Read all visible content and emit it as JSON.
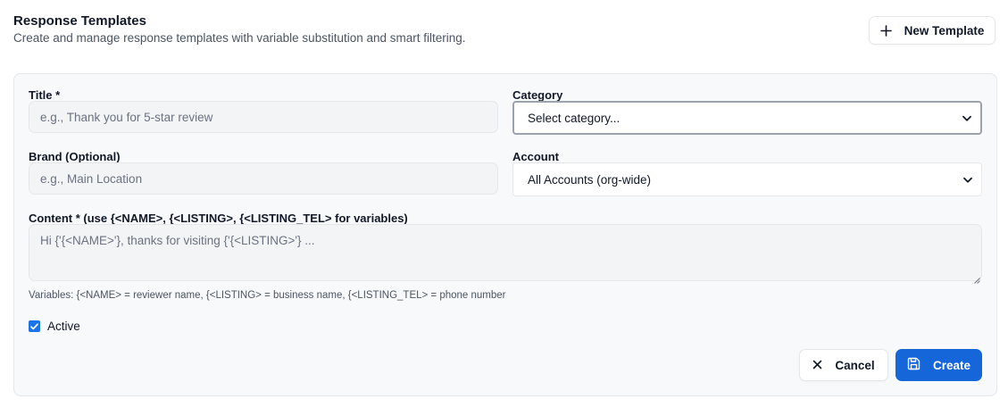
{
  "header": {
    "title": "Response Templates",
    "subtitle": "Create and manage response templates with variable substitution and smart filtering.",
    "new_button_label": "New Template"
  },
  "form": {
    "title": {
      "label": "Title *",
      "value": "",
      "placeholder": "e.g., Thank you for 5-star review"
    },
    "category": {
      "label": "Category",
      "selected": "Select category..."
    },
    "brand": {
      "label": "Brand (Optional)",
      "value": "",
      "placeholder": "e.g., Main Location"
    },
    "account": {
      "label": "Account",
      "selected": "All Accounts (org-wide)"
    },
    "content": {
      "label": "Content * (use {<NAME>, {<LISTING>, {<LISTING_TEL> for variables)",
      "value": "",
      "placeholder": "Hi {'{<NAME>'}, thanks for visiting {'{<LISTING>'} ..."
    },
    "variables_hint": "Variables: {<NAME> = reviewer name, {<LISTING> = business name, {<LISTING_TEL> = phone number",
    "active": {
      "label": "Active",
      "checked": true
    }
  },
  "actions": {
    "cancel_label": "Cancel",
    "create_label": "Create"
  },
  "colors": {
    "primary": "#1566d8",
    "checkbox": "#1a73e8",
    "panel_bg": "#f8f9fb",
    "border": "#e5e7eb"
  },
  "icons": {
    "new_template": "plus-icon",
    "cancel": "close-icon",
    "create": "save-icon",
    "select": "chevron-down-icon"
  }
}
